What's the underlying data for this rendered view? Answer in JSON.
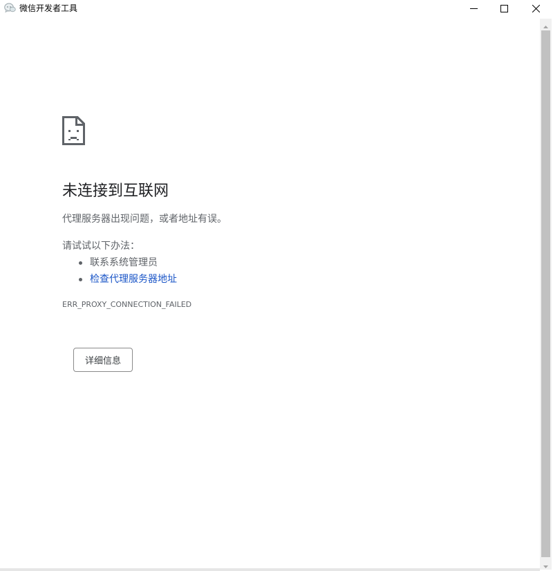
{
  "window": {
    "title": "微信开发者工具",
    "icons": {
      "app": "wechat-devtools-icon",
      "minimize": "minimize-icon",
      "maximize": "maximize-icon",
      "close": "close-icon"
    }
  },
  "error": {
    "icon": "sad-page-icon",
    "heading": "未连接到互联网",
    "description": "代理服务器出现问题，或者地址有误。",
    "try_label": "请试试以下办法：",
    "suggestions": [
      {
        "text": "联系系统管理员",
        "link": false
      },
      {
        "text": "检查代理服务器地址",
        "link": true
      }
    ],
    "code": "ERR_PROXY_CONNECTION_FAILED",
    "details_button": "详细信息"
  },
  "colors": {
    "heading": "#202124",
    "body_text": "#5f6368",
    "link": "#1a55c7",
    "button_border": "#8a8a8a",
    "scrollbar_thumb": "#c1c1c1"
  }
}
